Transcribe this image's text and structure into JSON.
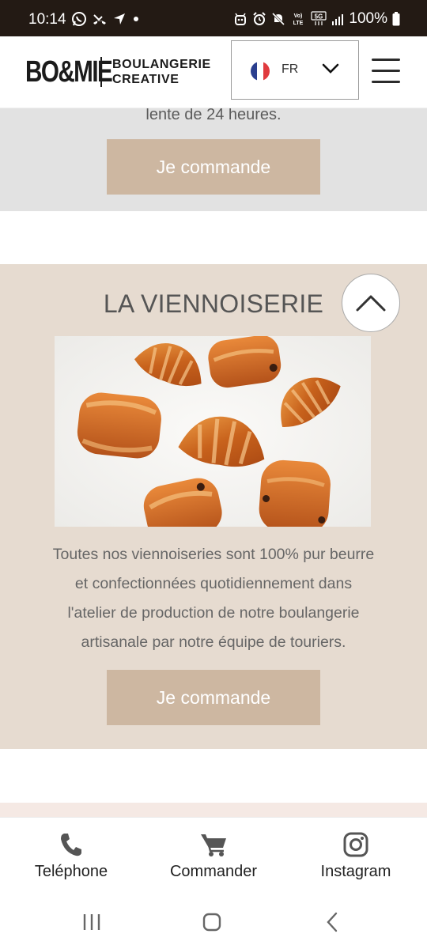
{
  "status_bar": {
    "time": "10:14",
    "battery": "100%",
    "left_icons": [
      "whatsapp-icon",
      "missed-call-icon",
      "navigation-icon",
      "dot-icon"
    ],
    "right_icons": [
      "android-icon",
      "alarm-icon",
      "mute-icon",
      "volte-icon",
      "5g-icon",
      "signal-icon",
      "battery-icon"
    ],
    "volte_text": "Vo)\nLTE",
    "network": "5G"
  },
  "header": {
    "logo_mark": "BO&MIE",
    "logo_line1": "BOULANGERIE",
    "logo_line2": "CREATIVE",
    "language": "FR",
    "flag_colors": [
      "#2a3f8f",
      "#ffffff",
      "#e03a3e"
    ]
  },
  "sections": {
    "prev": {
      "text_tail": "lente de 24 heures.",
      "cta": "Je commande"
    },
    "viennoiserie": {
      "title": "LA VIENNOISERIE",
      "description_lines": [
        "Toutes nos viennoiseries sont 100% pur beurre",
        "et confectionnées quotidiennement dans",
        "l'atelier de production de notre boulangerie",
        "artisanale par notre équipe de touriers."
      ],
      "cta": "Je commande"
    }
  },
  "bottom_bar": {
    "items": [
      {
        "label": "Teléphone",
        "icon": "phone-icon"
      },
      {
        "label": "Commander",
        "icon": "cart-icon"
      },
      {
        "label": "Instagram",
        "icon": "instagram-icon"
      }
    ]
  },
  "colors": {
    "status_bar": "#231a14",
    "cta": "#cdb7a1",
    "section_beige": "#e6dbd0",
    "section_grey": "#e2e2e2",
    "section_blush": "#f5e9e4"
  }
}
